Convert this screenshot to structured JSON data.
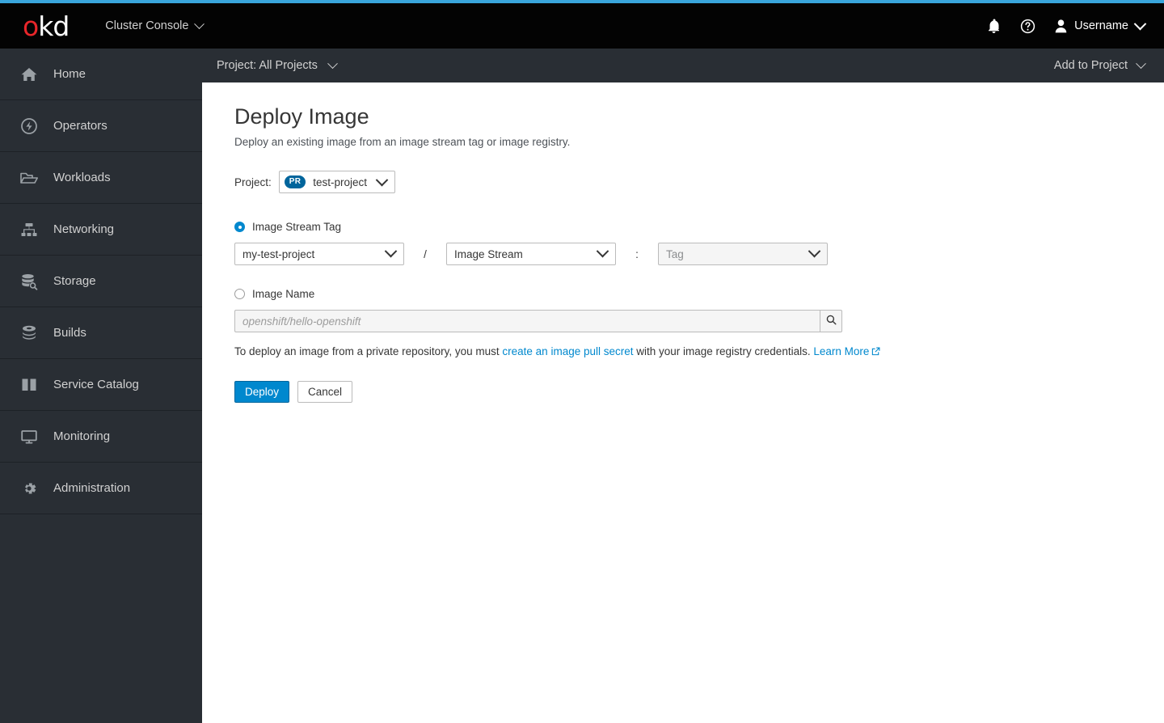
{
  "accent_color": "#39a5dc",
  "masthead": {
    "logo_text_1": "o",
    "logo_text_2": "kd",
    "console_switcher_label": "Cluster Console",
    "notifications_icon": "bell-icon",
    "help_icon": "help-circle-icon",
    "user_icon": "user-avatar-icon",
    "username": "Username"
  },
  "project_bar": {
    "project_selector_label": "Project: All Projects",
    "add_to_project_label": "Add to Project"
  },
  "sidebar": {
    "items": [
      {
        "label": "Home",
        "icon": "home-icon"
      },
      {
        "label": "Operators",
        "icon": "operators-bolt-icon"
      },
      {
        "label": "Workloads",
        "icon": "folder-open-icon"
      },
      {
        "label": "Networking",
        "icon": "sitemap-icon"
      },
      {
        "label": "Storage",
        "icon": "database-search-icon"
      },
      {
        "label": "Builds",
        "icon": "layers-icon"
      },
      {
        "label": "Service Catalog",
        "icon": "open-book-icon"
      },
      {
        "label": "Monitoring",
        "icon": "monitor-screen-icon"
      },
      {
        "label": "Administration",
        "icon": "gear-icon"
      }
    ]
  },
  "main": {
    "title": "Deploy Image",
    "subtitle": "Deploy an existing image from an image stream tag or image registry.",
    "project_row": {
      "label": "Project:",
      "badge": "PR",
      "value": "test-project",
      "badge_color": "#00659c"
    },
    "image_stream_tag": {
      "radio_label": "Image Stream Tag",
      "selected": true,
      "namespace_value": "my-test-project",
      "separator_slash": "/",
      "image_stream_value": "Image Stream",
      "separator_colon": ":",
      "tag_value": "Tag"
    },
    "image_name": {
      "radio_label": "Image Name",
      "selected": false,
      "placeholder": "openshift/hello-openshift",
      "value": "",
      "search_icon": "search-icon"
    },
    "help_text": {
      "part1": "To deploy an image from a private repository, you must ",
      "link1": "create an image pull secret",
      "part2": " with your image registry credentials. ",
      "link2": "Learn More",
      "external_icon": "external-link-icon",
      "link_color": "#0088ce"
    },
    "actions": {
      "deploy_label": "Deploy",
      "cancel_label": "Cancel",
      "deploy_color": "#0088ce"
    }
  }
}
